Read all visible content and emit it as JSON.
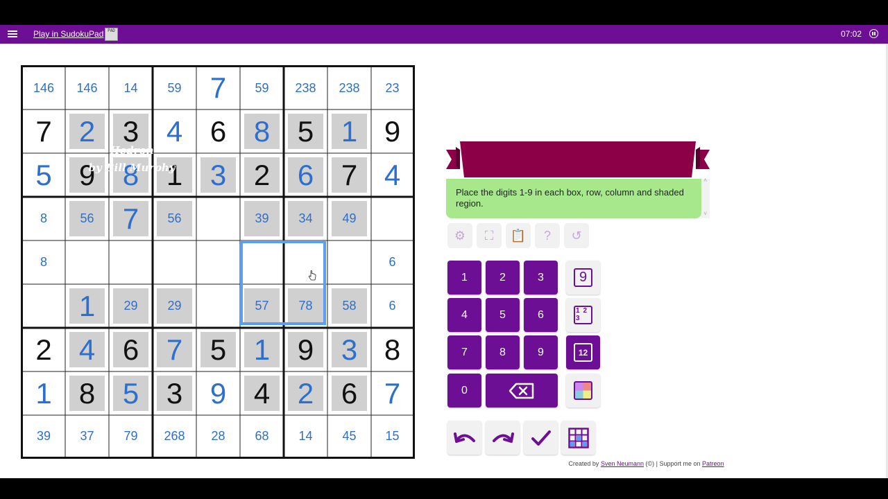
{
  "header": {
    "app_link": "Play in SudokuPad",
    "logo_text": "PAD",
    "timer": "07:02"
  },
  "puzzle": {
    "title_line1": "Hedron",
    "title_line2": "by Bill Murphy",
    "rules": "Place the digits 1-9 in each box, row, column and shaded region."
  },
  "board": {
    "shaded_rows": [
      "011001110",
      "011111110",
      "011101110",
      "000000000",
      "011101110",
      "011111110",
      "011101110"
    ],
    "cells": [
      [
        "c146",
        "c146",
        "c14",
        "c59",
        "p7",
        "c59",
        "c238",
        "c238",
        "c23"
      ],
      [
        "g7",
        "p2",
        "g3",
        "p4",
        "g6",
        "p8",
        "g5",
        "p1",
        "g9"
      ],
      [
        "p5",
        "g9",
        "p8",
        "g1",
        "p3",
        "g2",
        "p6",
        "g7",
        "p4"
      ],
      [
        "c8",
        "c56",
        "p7",
        "c56",
        "",
        "c39",
        "c34",
        "c49",
        ""
      ],
      [
        "c8",
        "",
        "",
        "",
        "",
        "",
        "",
        "",
        "c6"
      ],
      [
        "",
        "p1",
        "c29",
        "c29",
        "",
        "c57",
        "c78",
        "c58",
        "c6"
      ],
      [
        "g2",
        "p4",
        "g6",
        "p7",
        "g5",
        "p1",
        "g9",
        "p3",
        "g8"
      ],
      [
        "p1",
        "g8",
        "p5",
        "g3",
        "p9",
        "g4",
        "p2",
        "g6",
        "p7"
      ],
      [
        "c39",
        "c37",
        "c79",
        "c268",
        "c28",
        "c68",
        "c14",
        "c45",
        "c15"
      ]
    ]
  },
  "keypad": {
    "digits": [
      "1",
      "2",
      "3",
      "4",
      "5",
      "6",
      "7",
      "8",
      "9",
      "0"
    ],
    "mode_normal": "9",
    "mode_corner": [
      "1",
      "2",
      "3",
      ""
    ],
    "mode_centre": "12"
  },
  "footer": {
    "created_by": "Created by",
    "author": "Sven Neumann",
    "copyright": "(©) | Support me on",
    "patreon": "Patreon"
  },
  "colors": {
    "accent": "#6c0f95",
    "banner": "#8b0046",
    "rules_bg": "#a8e88d",
    "user_digit": "#2c6fcc",
    "selection": "#5b9ef2"
  },
  "icons": [
    "menu-icon",
    "pause-icon",
    "settings-icon",
    "fullscreen-icon",
    "clipboard-icon",
    "help-icon",
    "restart-icon",
    "backspace-icon",
    "undo-icon",
    "redo-icon",
    "check-icon",
    "grid-icon"
  ]
}
